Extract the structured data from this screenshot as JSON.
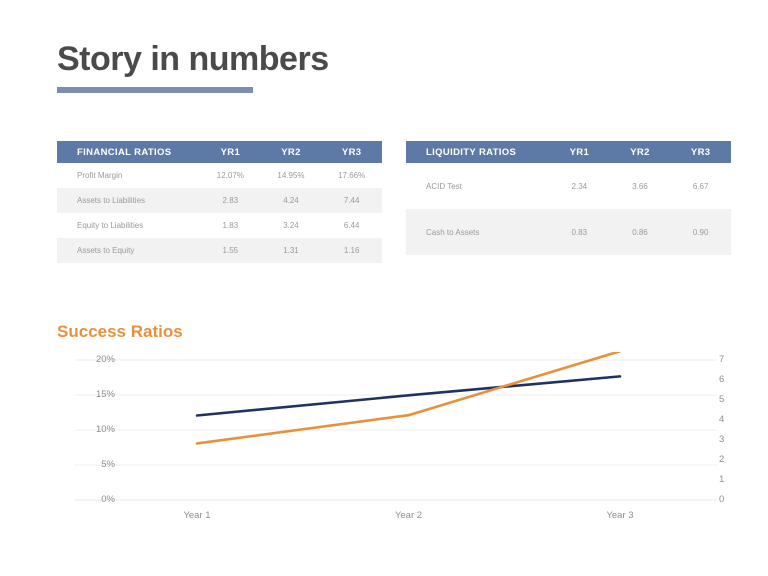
{
  "slide": {
    "title": "Story in numbers",
    "accent_title_bar": "#7b8db0",
    "title_color": "#4a4a4a"
  },
  "financial_table": {
    "name": "financial-ratios-table",
    "header_color": "#5d79a6",
    "columns": [
      "FINANCIAL RATIOS",
      "YR1",
      "YR2",
      "YR3"
    ],
    "rows": [
      {
        "label": "Profit Margin",
        "yr1": "12.07%",
        "yr2": "14.95%",
        "yr3": "17.66%"
      },
      {
        "label": "Assets to Liabilities",
        "yr1": "2.83",
        "yr2": "4.24",
        "yr3": "7.44"
      },
      {
        "label": "Equity to Liabilities",
        "yr1": "1.83",
        "yr2": "3.24",
        "yr3": "6.44"
      },
      {
        "label": "Assets to Equity",
        "yr1": "1.55",
        "yr2": "1.31",
        "yr3": "1.16"
      }
    ]
  },
  "liquidity_table": {
    "name": "liquidity-ratios-table",
    "header_color": "#5d79a6",
    "columns": [
      "LIQUIDITY RATIOS",
      "YR1",
      "YR2",
      "YR3"
    ],
    "rows": [
      {
        "label": "ACID Test",
        "yr1": "2.34",
        "yr2": "3.66",
        "yr3": "6.67"
      },
      {
        "label": "Cash to Assets",
        "yr1": "0.83",
        "yr2": "0.86",
        "yr3": "0.90"
      }
    ]
  },
  "chart_data": {
    "type": "line",
    "title": "Success Ratios",
    "title_color": "#e8913c",
    "xlabel": "",
    "ylabel": "",
    "categories": [
      "Year 1",
      "Year 2",
      "Year 3"
    ],
    "grid": true,
    "legend": "none",
    "left_axis": {
      "ticks": [
        "0%",
        "5%",
        "10%",
        "15%",
        "20%"
      ],
      "ylim": [
        0,
        20
      ],
      "format": "percent"
    },
    "right_axis": {
      "ticks": [
        "0",
        "1",
        "2",
        "3",
        "4",
        "5",
        "6",
        "7"
      ],
      "ylim": [
        0,
        7
      ],
      "format": "number"
    },
    "series": [
      {
        "name": "Profit Margin",
        "axis": "left",
        "color": "#1f3260",
        "values": [
          12.07,
          14.95,
          17.66
        ]
      },
      {
        "name": "Assets to Liabilities",
        "axis": "right",
        "color": "#e8913c",
        "values": [
          2.83,
          4.24,
          7.44
        ]
      }
    ]
  },
  "chart_axis": {
    "left": [
      "20%",
      "15%",
      "10%",
      "5%",
      "0%"
    ],
    "right": [
      "7",
      "6",
      "5",
      "4",
      "3",
      "2",
      "1",
      "0"
    ],
    "x": [
      "Year 1",
      "Year 2",
      "Year 3"
    ]
  }
}
